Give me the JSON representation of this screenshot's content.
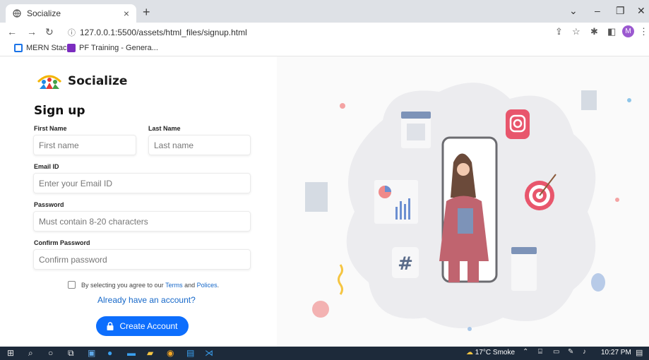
{
  "browser": {
    "tab_title": "Socialize",
    "tab_close": "×",
    "new_tab": "+",
    "url": "127.0.0.1:5500/assets/html_files/signup.html",
    "bookmarks": [
      {
        "label": "MERN Stack",
        "color": "#1a73e8"
      },
      {
        "label": "PF Training - Genera...",
        "color": "#7b2cbf"
      }
    ],
    "avatar_letter": "M"
  },
  "logo": {
    "text": "Socialize"
  },
  "form": {
    "title": "Sign up",
    "first_name": {
      "label": "First Name",
      "placeholder": "First name"
    },
    "last_name": {
      "label": "Last Name",
      "placeholder": "Last name"
    },
    "email": {
      "label": "Email ID",
      "placeholder": "Enter your Email ID"
    },
    "password": {
      "label": "Password",
      "placeholder": "Must contain 8-20 characters"
    },
    "confirm_password": {
      "label": "Confirm Password",
      "placeholder": "Confirm password"
    },
    "agree": {
      "prefix": "By selecting you agree to our",
      "terms": "Terms",
      "and": "and",
      "policies": "Polices",
      "suffix": "."
    },
    "already_account": "Already have an account?",
    "create_button": "Create Account"
  },
  "taskbar": {
    "weather": "17°C Smoke",
    "time": "10:27 PM"
  },
  "colors": {
    "primary": "#0d6efd",
    "link": "#1668c9"
  }
}
